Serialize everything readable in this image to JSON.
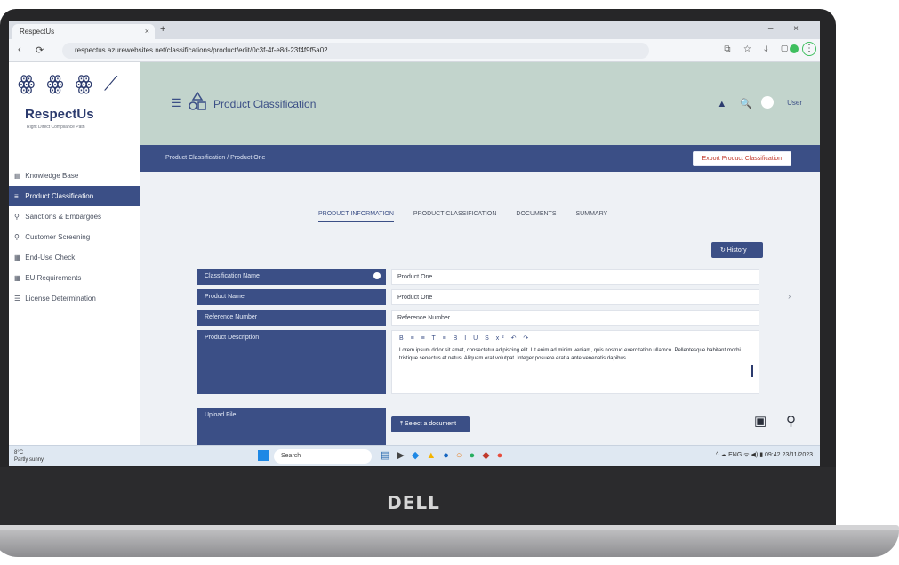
{
  "browser": {
    "tab_title": "RespectUs",
    "tab_close": "×",
    "new_tab": "+",
    "window_controls": "–  ×",
    "nav_back": "‹",
    "nav_reload": "⟳",
    "url": "respectus.azurewebsites.net/classifications/product/edit/0c3f-4f-e8d-23f4f9f5a02",
    "toolbar_icons": "⧉ ☆ ⤓ ▢",
    "menu": "⋮"
  },
  "sidebar": {
    "logo_glyphs": "ꙮ ꙮ ꙮ ⟋",
    "brand": "RespectUs",
    "tagline": "Right Direct Compliance Path",
    "items": [
      {
        "icon": "▤",
        "label": "Knowledge Base"
      },
      {
        "icon": "≡",
        "label": "Product Classification"
      },
      {
        "icon": "⚲",
        "label": "Sanctions & Embargoes"
      },
      {
        "icon": "⚲",
        "label": "Customer Screening"
      },
      {
        "icon": "▦",
        "label": "End-Use Check"
      },
      {
        "icon": "▦",
        "label": "EU Requirements"
      },
      {
        "icon": "☰",
        "label": "License Determination"
      }
    ]
  },
  "header": {
    "menu_icon": "☰",
    "title": "Product Classification",
    "icons": "▲ 🔍",
    "user": "User"
  },
  "subbar": {
    "breadcrumb": "Product Classification / Product One",
    "action": "Export Product Classification"
  },
  "tabs": [
    {
      "label": "PRODUCT INFORMATION",
      "active": true
    },
    {
      "label": "PRODUCT CLASSIFICATION",
      "active": false
    },
    {
      "label": "DOCUMENTS",
      "active": false
    },
    {
      "label": "SUMMARY",
      "active": false
    }
  ],
  "history_button": "↻ History",
  "form": {
    "classification_label": "Classification Name",
    "classification_value": "Product One",
    "product_name_label": "Product Name",
    "product_name_value": "Product One",
    "reference_label": "Reference Number",
    "reference_value": "Reference Number",
    "description_label": "Product Description",
    "editor_tools": "B ≡ ≡ T ≡ B I U S x² ↶ ↷",
    "description_text": "Lorem ipsum dolor sit amet, consectetur adipiscing elit. Ut enim ad minim veniam, quis nostrud exercitation ullamco. Pellentesque habitant morbi tristique senectus et netus. Aliquam erat volutpat. Integer posuere erat a ante venenatis dapibus.",
    "upload_label": "Upload File",
    "upload_button": "⤒ Select a document"
  },
  "floating": {
    "doc_icon": "▣",
    "zoom_icon": "⚲",
    "side_glyph": "›"
  },
  "taskbar": {
    "weather": "8°C\nPartly sunny",
    "search": "Search",
    "apps": "▤ ▶ ◆ ▲ ● ○ ● ◆ ●",
    "tray": "^ ☁ ENG ᯤ ◀) ▮  09:42  23/11/2023"
  },
  "laptop_brand": "DELL"
}
